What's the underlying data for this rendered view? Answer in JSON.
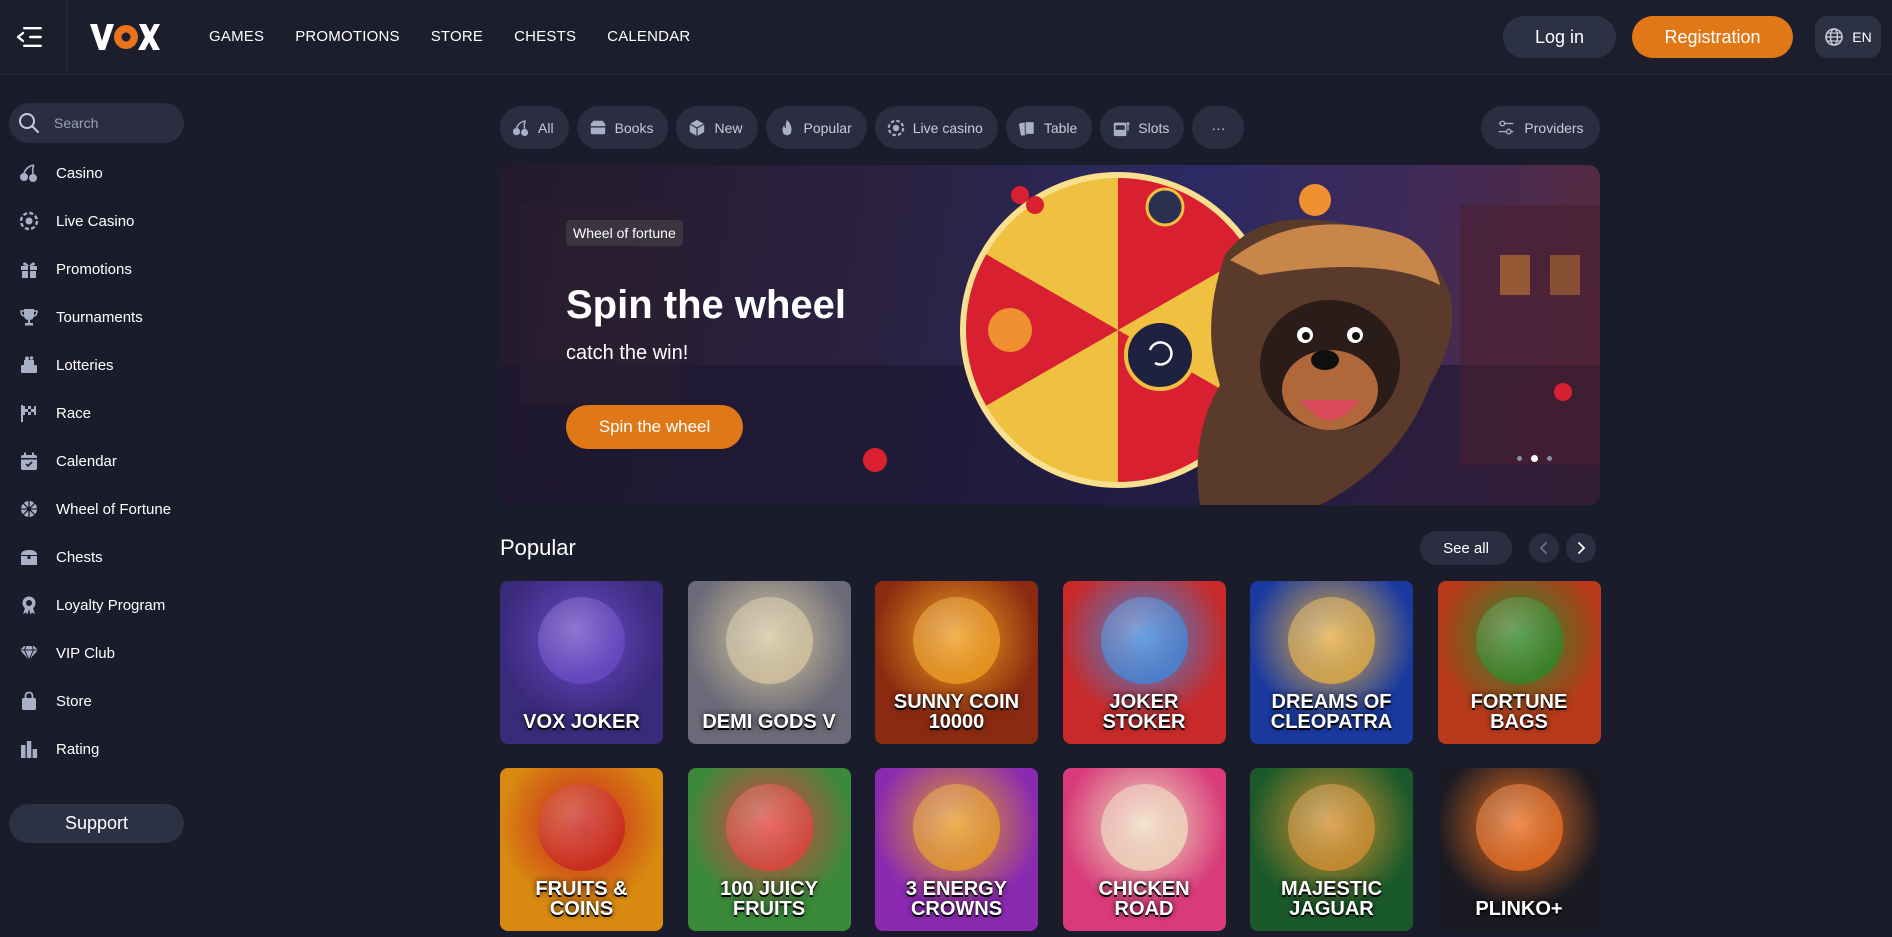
{
  "header": {
    "logo_text": "VOX",
    "nav": [
      "GAMES",
      "PROMOTIONS",
      "STORE",
      "CHESTS",
      "CALENDAR"
    ],
    "login_label": "Log in",
    "register_label": "Registration",
    "language": "EN"
  },
  "sidebar": {
    "search_placeholder": "Search",
    "items": [
      {
        "label": "Casino",
        "icon": "cherries-icon"
      },
      {
        "label": "Live Casino",
        "icon": "chip-icon"
      },
      {
        "label": "Promotions",
        "icon": "gift-icon"
      },
      {
        "label": "Tournaments",
        "icon": "trophy-icon"
      },
      {
        "label": "Lotteries",
        "icon": "lottery-icon"
      },
      {
        "label": "Race",
        "icon": "flag-icon"
      },
      {
        "label": "Calendar",
        "icon": "calendar-icon"
      },
      {
        "label": "Wheel of Fortune",
        "icon": "wheel-icon"
      },
      {
        "label": "Chests",
        "icon": "chest-icon"
      },
      {
        "label": "Loyalty Program",
        "icon": "medal-icon"
      },
      {
        "label": "VIP Club",
        "icon": "diamond-icon"
      },
      {
        "label": "Store",
        "icon": "bag-icon"
      },
      {
        "label": "Rating",
        "icon": "rating-icon"
      }
    ],
    "support_label": "Support"
  },
  "filters": {
    "chips": [
      {
        "label": "All",
        "icon": "cherries-icon"
      },
      {
        "label": "Books",
        "icon": "book-icon"
      },
      {
        "label": "New",
        "icon": "cube-icon"
      },
      {
        "label": "Popular",
        "icon": "fire-icon"
      },
      {
        "label": "Live casino",
        "icon": "chip-icon"
      },
      {
        "label": "Table",
        "icon": "cards-icon"
      },
      {
        "label": "Slots",
        "icon": "slot-machine-icon"
      }
    ],
    "more_label": "···",
    "providers_label": "Providers"
  },
  "banner": {
    "tag": "Wheel of fortune",
    "title": "Spin the wheel",
    "subtitle": "catch the win!",
    "button_label": "Spin the wheel",
    "slide_count": 3,
    "active_slide": 2
  },
  "popular": {
    "title": "Popular",
    "see_all_label": "See all",
    "games": [
      {
        "name": "Vox Joker",
        "bg": "#3a2a7a",
        "accent": "#6a4ac8"
      },
      {
        "name": "Demi Gods V",
        "bg": "#6a6a78",
        "accent": "#d8c8a0"
      },
      {
        "name": "Sunny Coin 10000",
        "bg": "#8a2a10",
        "accent": "#f0a020"
      },
      {
        "name": "Joker Stoker",
        "bg": "#c82a2a",
        "accent": "#3a8ae0"
      },
      {
        "name": "Dreams of Cleopatra",
        "bg": "#1a3aa0",
        "accent": "#e8b040"
      },
      {
        "name": "Fortune Bags",
        "bg": "#b83a1a",
        "accent": "#2a8a2a"
      },
      {
        "name": "Fruits & Coins",
        "bg": "#d88a10",
        "accent": "#c82020"
      },
      {
        "name": "100 Juicy Fruits",
        "bg": "#3a8a3a",
        "accent": "#e84040"
      },
      {
        "name": "3 Energy Crowns",
        "bg": "#8a2ab0",
        "accent": "#e8a020"
      },
      {
        "name": "Chicken Road",
        "bg": "#d83a7a",
        "accent": "#f0e0c0"
      },
      {
        "name": "Majestic Jaguar",
        "bg": "#1a5a2a",
        "accent": "#d89030"
      },
      {
        "name": "Plinko+",
        "bg": "#1a1a22",
        "accent": "#f07020"
      }
    ]
  }
}
